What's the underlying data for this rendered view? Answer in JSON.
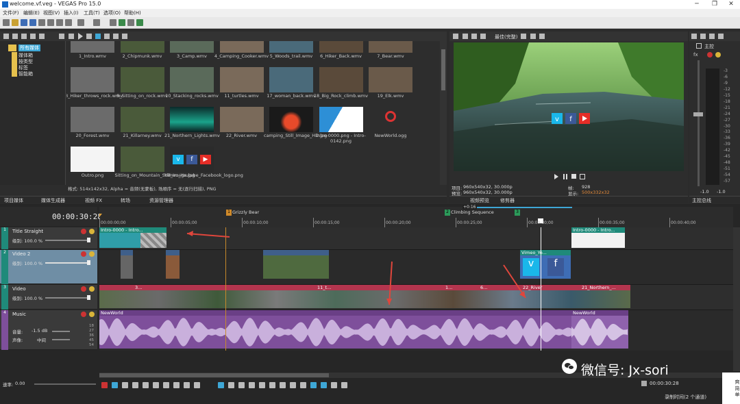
{
  "app": {
    "title": "welcome.vf.veg - VEGAS Pro 15.0"
  },
  "menu": [
    "文件(F)",
    "编辑(E)",
    "视图(V)",
    "插入(I)",
    "工具(T)",
    "选项(O)",
    "帮助(H)"
  ],
  "colors": {
    "accent": "#3ea7d6",
    "title_track": "#1f8a7a",
    "video_track": "#b3354e",
    "music_track": "#7e4f9b",
    "window_bg": "#2b2b2b",
    "arrow": "#e0463c"
  },
  "explorer": {
    "tree": [
      "所有媒体",
      "媒体箱",
      "按类型",
      "标签",
      "智能箱"
    ],
    "media": [
      {
        "name": "1_Intro.wmv"
      },
      {
        "name": "2_Chipmunk.wmv"
      },
      {
        "name": "3_Camp.wmv"
      },
      {
        "name": "4_Camping_Cooker.wmv"
      },
      {
        "name": "5_Woods_trail.wmv"
      },
      {
        "name": "6_Hiker_Back.wmv"
      },
      {
        "name": "7_Bear.wmv"
      },
      {
        "name": "8_Hiker_throws_rock.wmv"
      },
      {
        "name": "9_Sitting_on_rock.wmv"
      },
      {
        "name": "10_Stacking_rocks.wmv"
      },
      {
        "name": "11_turtles.wmv"
      },
      {
        "name": "17_woman_back.wmv"
      },
      {
        "name": "18_Big_Rock_climb.wmv"
      },
      {
        "name": "19_Elk.wmv"
      },
      {
        "name": "20_Forest.wmv"
      },
      {
        "name": "21_Killarney.wmv"
      },
      {
        "name": "21_Northern_Lights.wmv"
      },
      {
        "name": "22_River.wmv"
      },
      {
        "name": "camping_Still_Image_HD.jpg"
      },
      {
        "name": "Intro-0000.png - Intro-0142.png"
      },
      {
        "name": "NewWorld.ogg"
      },
      {
        "name": "Outro.png"
      },
      {
        "name": "Sitting_on_Mountain_Still_Image.jpg"
      },
      {
        "name": "Vimeo_Youtube_Facebook_logo.png"
      }
    ],
    "status": "格式: 514x142x32, Alpha = 音频(无蒙板), 场顺序 = 无(逐行扫描), PNG",
    "tabs": [
      "项目媒体",
      "媒体生成器",
      "视频 FX",
      "转场",
      "资源管理器"
    ]
  },
  "preview": {
    "quality": "最佳(完整)",
    "project_label": "项目:",
    "project": "960x540x32, 30.000p",
    "preview_label": "预览:",
    "preview_res": "960x540x32, 30.000p",
    "frame_label": "帧:",
    "frame": "928",
    "display_label": "显示:",
    "display": "500x332x32",
    "tabs": [
      "视频预览",
      "修剪器"
    ]
  },
  "master": {
    "label": "主控",
    "scale": [
      "3",
      "6",
      "9",
      "12",
      "15",
      "18",
      "21",
      "24",
      "27",
      "30",
      "33",
      "36",
      "39",
      "42",
      "45",
      "48",
      "51",
      "54",
      "57"
    ],
    "levels": [
      "-1.0",
      "-1.0"
    ],
    "tab": "主控总线"
  },
  "timeline": {
    "timecode": "00:00:30:28",
    "markers": [
      "Grizzly Bear",
      "Climbing Sequence"
    ],
    "marker_numbers": [
      "1",
      "2",
      "3"
    ],
    "cursor_label": "+0:16",
    "ruler": [
      "00:00:00;00",
      "00:00:05;00",
      "00:00:10;00",
      "00:00:15;00",
      "00:00:20;00",
      "00:00:25;00",
      "00:00:30;00",
      "00:00:35;00",
      "00:00:40;00"
    ],
    "tracks": [
      {
        "num": "1",
        "name": "Title Straight",
        "level": "级别: 100.0 %"
      },
      {
        "num": "2",
        "name": "Video 2",
        "level": "级别: 100.0 %"
      },
      {
        "num": "3",
        "name": "Video",
        "level": "级别: 100.0 %"
      },
      {
        "num": "4",
        "name": "Music",
        "volume_label": "音量:",
        "volume": "-1.5 dB",
        "pan_label": "声像:",
        "pan": "中间",
        "db_scale": [
          "18",
          "27",
          "36",
          "45",
          "54"
        ]
      }
    ],
    "clips": {
      "title1": "Intro-0000 - Intro...",
      "title2": "Intro-0000 - Intro...",
      "vimeo": "Vimeo_Yo...",
      "v_3": "3...",
      "v_11": "11_t...",
      "v_22": "22_River",
      "v_21": "21_Northern_...",
      "v_1": "1...",
      "v_6": "6...",
      "music1": "NewWorld",
      "music2": "NewWorld"
    },
    "rate_label": "速率:",
    "rate": "0.00",
    "end_timecode": "00:00:30:28",
    "status": "录制时间(2 个通道)"
  },
  "watermark": {
    "text": "微信号: Jx-sori",
    "avatar_text": "爽 简 单"
  }
}
